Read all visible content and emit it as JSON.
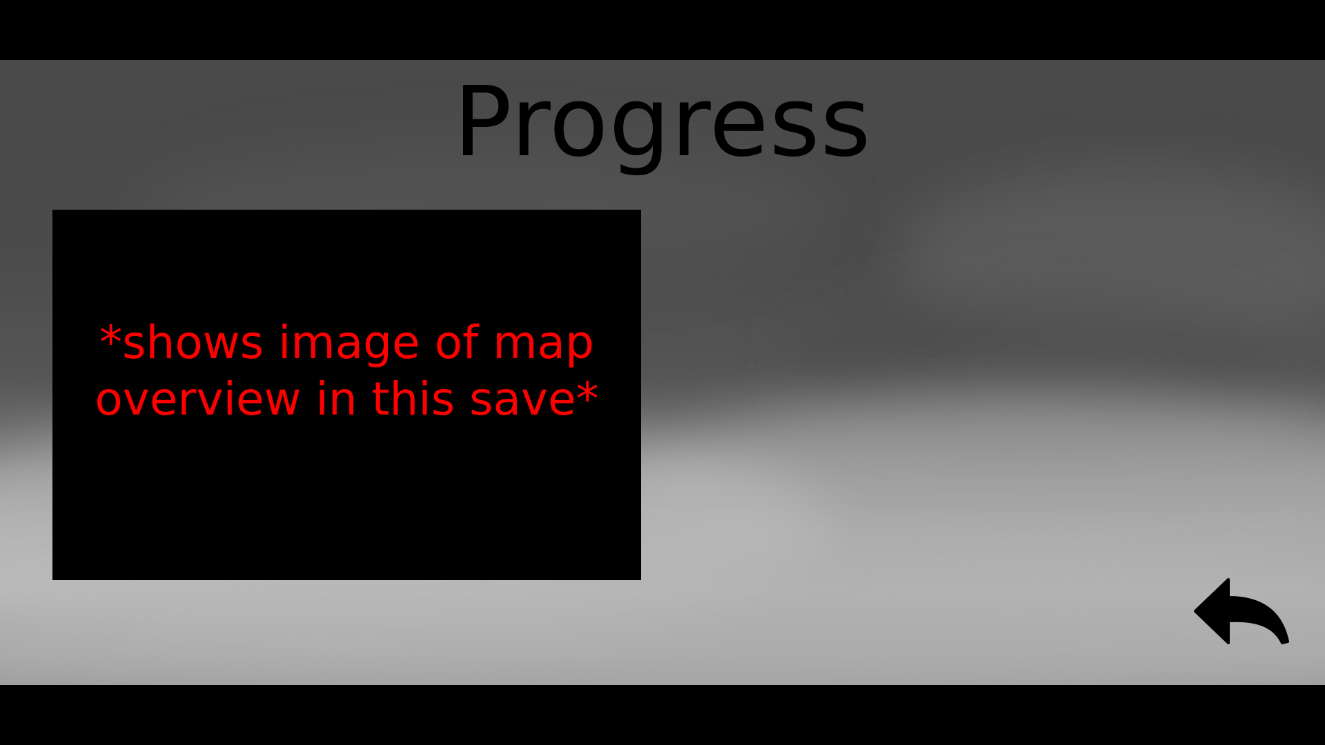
{
  "screen": {
    "title": "Progress"
  },
  "map_preview": {
    "placeholder_text": "*shows image of map\noverview in this save*"
  },
  "back_button": {
    "icon": "back-arrow-icon"
  },
  "colors": {
    "title": "#000000",
    "placeholder_text": "#ff0000",
    "panel": "#000000",
    "letterbox": "#000000"
  }
}
